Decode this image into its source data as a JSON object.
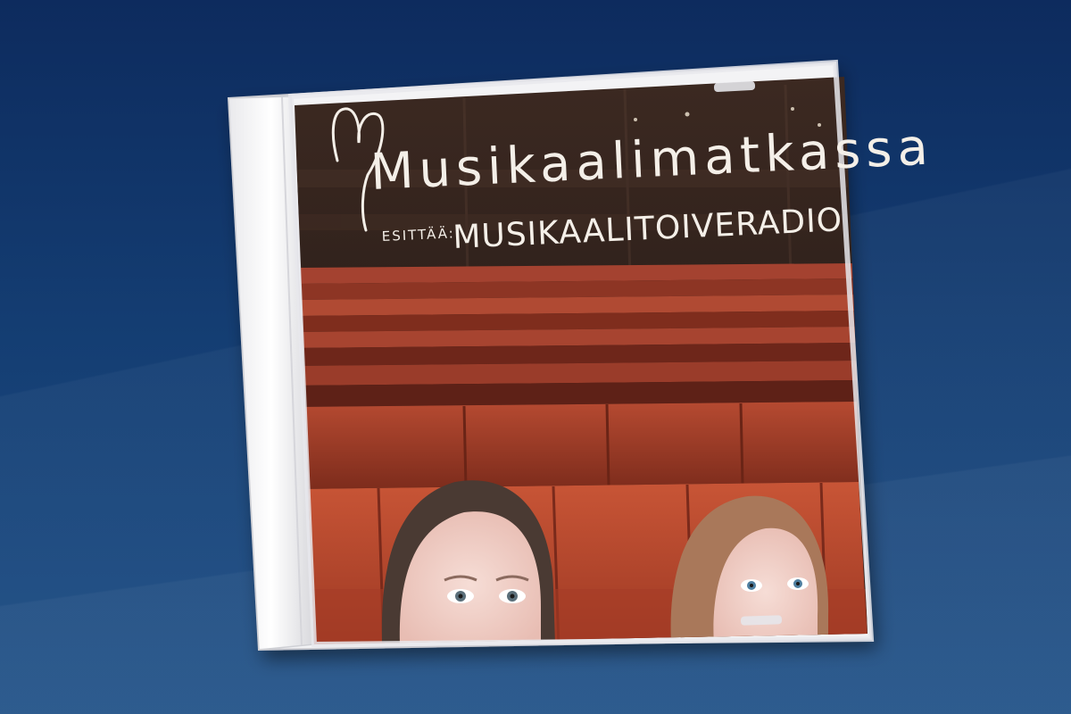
{
  "cover": {
    "title": "Musikaalimatkassa",
    "presents_label": "ESITTÄÄ:",
    "subtitle": "MUSIKAALITOIVERADIO"
  },
  "colors": {
    "background_top": "#0d2b5e",
    "background_bottom": "#1d4f86",
    "seat_red": "#b9492e",
    "seat_dark": "#7a2a1b",
    "title_text": "#f4efe8"
  }
}
